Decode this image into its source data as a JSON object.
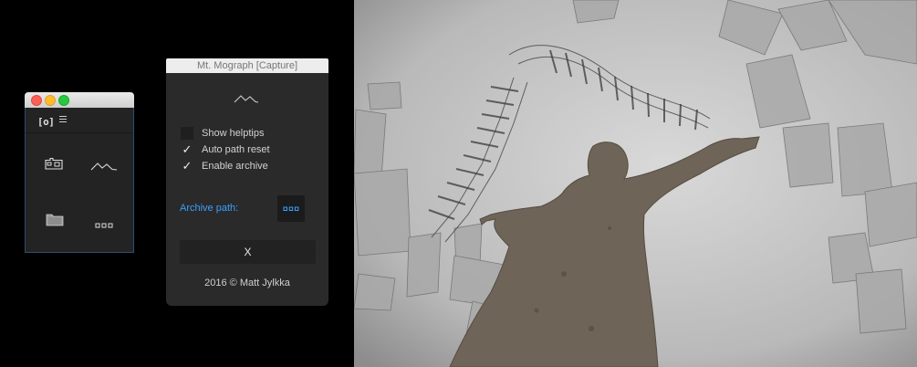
{
  "mini_window": {
    "toolbar": {
      "app_icon_label": "[o]",
      "menu_icon": "hamburger-icon"
    },
    "buttons": [
      {
        "icon": "camera-icon"
      },
      {
        "icon": "mountain-icon"
      },
      {
        "icon": "folder-icon"
      },
      {
        "icon": "dots-icon"
      }
    ],
    "colors": {
      "accent": "#2d4f74",
      "background": "#232323"
    }
  },
  "panel": {
    "title": "Mt. Mograph [Capture]",
    "logo_icon": "mountain-icon",
    "options": [
      {
        "label": "Show helptips",
        "checked": false
      },
      {
        "label": "Auto path reset",
        "checked": true
      },
      {
        "label": "Enable archive",
        "checked": true
      }
    ],
    "checkmark": "✓",
    "archive_path_label": "Archive path:",
    "archive_browse_icon": "dots-icon",
    "close_label": "X",
    "footer": "2016 © Matt Jylkka",
    "colors": {
      "link": "#3ba0ff",
      "background": "#2a2a2a"
    }
  }
}
